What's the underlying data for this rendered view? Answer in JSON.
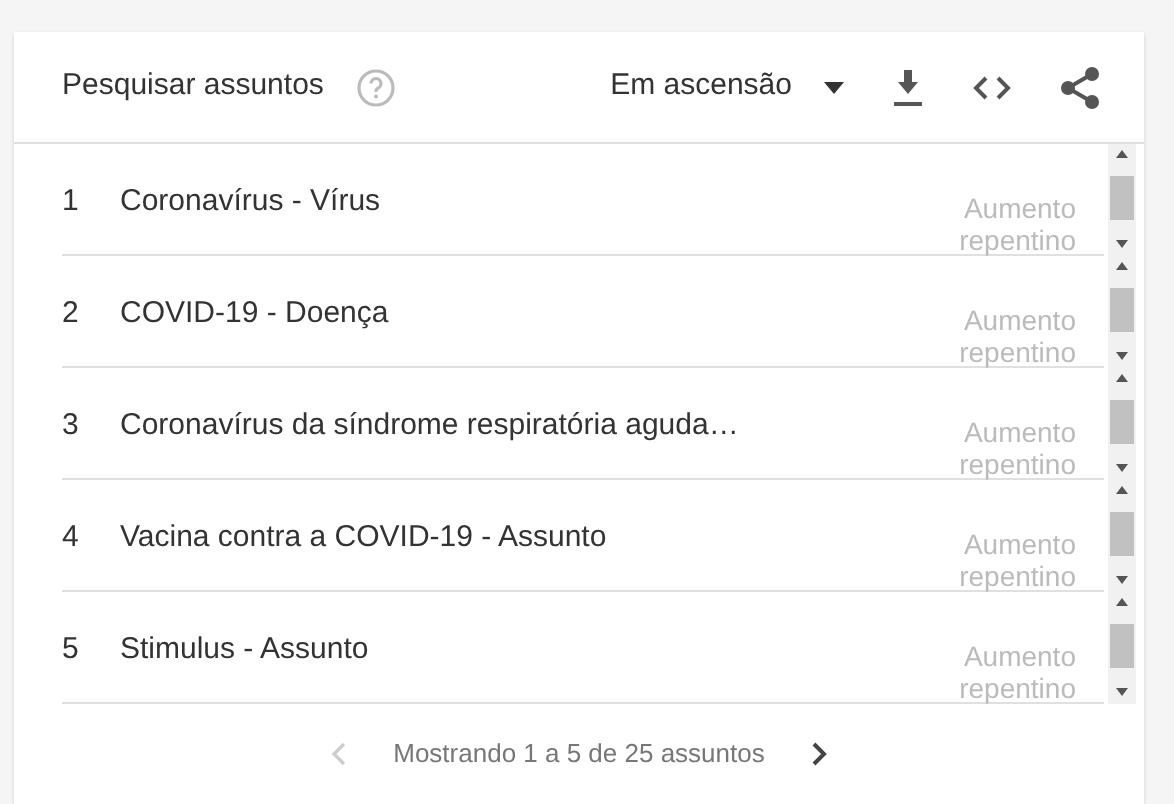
{
  "header": {
    "title": "Pesquisar assuntos",
    "filter": "Em ascensão"
  },
  "rows": [
    {
      "rank": "1",
      "name": "Coronavírus - Vírus",
      "value": "Aumento repentino"
    },
    {
      "rank": "2",
      "name": "COVID-19 - Doença",
      "value": "Aumento repentino"
    },
    {
      "rank": "3",
      "name": "Coronavírus da síndrome respiratória aguda…",
      "value": "Aumento repentino"
    },
    {
      "rank": "4",
      "name": "Vacina contra a COVID-19 - Assunto",
      "value": "Aumento repentino"
    },
    {
      "rank": "5",
      "name": "Stimulus - Assunto",
      "value": "Aumento repentino"
    }
  ],
  "pagination": {
    "text": "Mostrando 1 a 5 de 25 assuntos",
    "prev_disabled": true,
    "next_disabled": false
  }
}
